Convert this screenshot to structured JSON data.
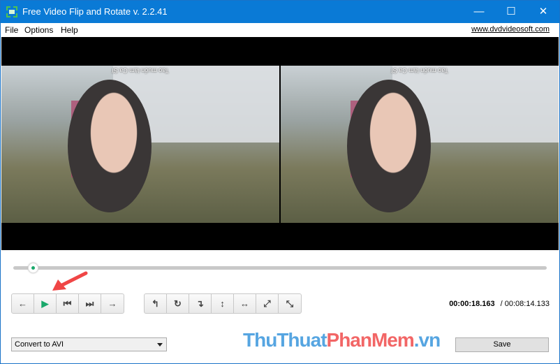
{
  "window": {
    "title": "Free Video Flip and Rotate v. 2.2.41",
    "minimize": "—",
    "maximize": "☐",
    "close": "✕"
  },
  "menu": {
    "items": [
      "File",
      "Options",
      "Help"
    ],
    "link": "www.dvdvideosoft.com"
  },
  "video": {
    "subtitle": "Tao muốn làm Ca Sĩ"
  },
  "player": {
    "position_fraction": 0.037,
    "buttons": [
      "←",
      "▶",
      "⏮",
      "⏭",
      "→"
    ]
  },
  "transform": {
    "buttons": [
      "↰",
      "↻",
      "↴",
      "↕",
      "↔",
      "⤢",
      "⤡"
    ]
  },
  "time": {
    "current": "00:00:18.163",
    "separator": "/",
    "total": "00:08:14.133"
  },
  "format": {
    "selected": "Convert to AVI"
  },
  "save_label": "Save",
  "watermark": {
    "part1": "Thu",
    "part2": "Thuat",
    "part3": "PhanMem",
    "part4": ".vn"
  },
  "colors": {
    "titlebar": "#0a7ad6",
    "play": "#1aa86b",
    "arrow": "#f04646"
  }
}
